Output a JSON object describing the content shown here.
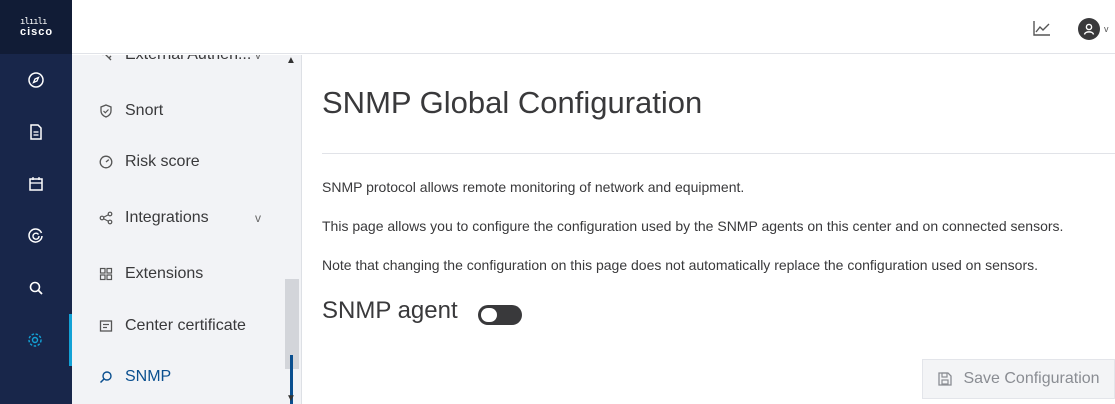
{
  "brand": {
    "logo_bars": "ılıılı",
    "name": "cisco"
  },
  "rail": {
    "icons": [
      "compass-icon",
      "document-icon",
      "calendar-icon",
      "radar-icon",
      "search-icon",
      "gear-icon"
    ],
    "active": "gear-icon",
    "expand_glyph": "→"
  },
  "topbar": {
    "icons": [
      "chart-icon",
      "user-avatar-icon"
    ],
    "caret": "v"
  },
  "subnav": {
    "items": [
      {
        "label": "External Authen...",
        "icon": "key-icon"
      },
      {
        "label": "Snort",
        "icon": "shield-icon"
      },
      {
        "label": "Risk score",
        "icon": "gauge-icon"
      },
      {
        "label": "Integrations",
        "icon": "share-icon",
        "expandable": true
      },
      {
        "label": "Extensions",
        "icon": "grid-icon"
      },
      {
        "label": "Center certificate",
        "icon": "certificate-icon"
      },
      {
        "label": "SNMP",
        "icon": "snmp-icon",
        "active": true
      }
    ],
    "chevron": "v"
  },
  "main": {
    "title": "SNMP Global Configuration",
    "paragraphs": [
      "SNMP protocol allows remote monitoring of network and equipment.",
      "This page allows you to configure the configuration used by the SNMP agents on this center and on connected sensors.",
      "Note that changing the configuration on this page does not automatically replace the configuration used on sensors."
    ],
    "agent_label": "SNMP agent",
    "agent_enabled": false,
    "save_label": "Save Configuration"
  },
  "colors": {
    "rail": "#18264a",
    "brand": "#111c36",
    "active_accent": "#13a2d6",
    "active_text": "#0a4f8f"
  }
}
